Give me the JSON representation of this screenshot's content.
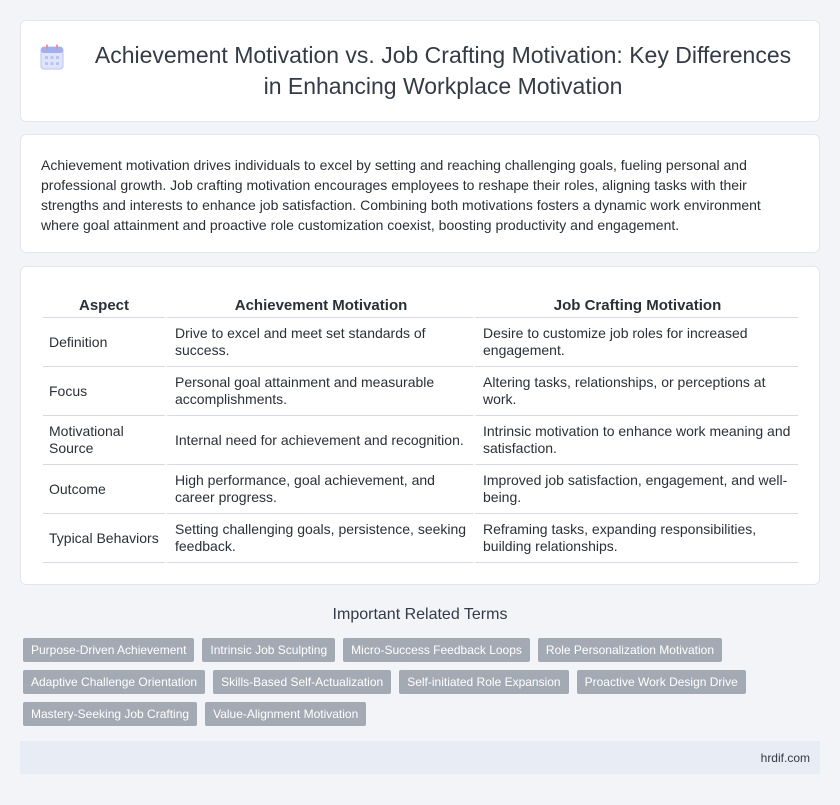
{
  "header": {
    "icon": "calendar-icon",
    "title": "Achievement Motivation vs. Job Crafting Motivation: Key Differences in Enhancing Workplace Motivation"
  },
  "intro": "Achievement motivation drives individuals to excel by setting and reaching challenging goals, fueling personal and professional growth. Job crafting motivation encourages employees to reshape their roles, aligning tasks with their strengths and interests to enhance job satisfaction. Combining both motivations fosters a dynamic work environment where goal attainment and proactive role customization coexist, boosting productivity and engagement.",
  "table": {
    "headers": [
      "Aspect",
      "Achievement Motivation",
      "Job Crafting Motivation"
    ],
    "rows": [
      [
        "Definition",
        "Drive to excel and meet set standards of success.",
        "Desire to customize job roles for increased engagement."
      ],
      [
        "Focus",
        "Personal goal attainment and measurable accomplishments.",
        "Altering tasks, relationships, or perceptions at work."
      ],
      [
        "Motivational Source",
        "Internal need for achievement and recognition.",
        "Intrinsic motivation to enhance work meaning and satisfaction."
      ],
      [
        "Outcome",
        "High performance, goal achievement, and career progress.",
        "Improved job satisfaction, engagement, and well-being."
      ],
      [
        "Typical Behaviors",
        "Setting challenging goals, persistence, seeking feedback.",
        "Reframing tasks, expanding responsibilities, building relationships."
      ]
    ]
  },
  "related": {
    "title": "Important Related Terms",
    "tags": [
      "Purpose-Driven Achievement",
      "Intrinsic Job Sculpting",
      "Micro-Success Feedback Loops",
      "Role Personalization Motivation",
      "Adaptive Challenge Orientation",
      "Skills-Based Self-Actualization",
      "Self-initiated Role Expansion",
      "Proactive Work Design Drive",
      "Mastery-Seeking Job Crafting",
      "Value-Alignment Motivation"
    ]
  },
  "footer": {
    "site": "hrdif.com"
  },
  "colors": {
    "tag_bg": "#a4aab4",
    "footer_bg": "#e8ecf5",
    "page_bg": "#f3f4f8"
  }
}
